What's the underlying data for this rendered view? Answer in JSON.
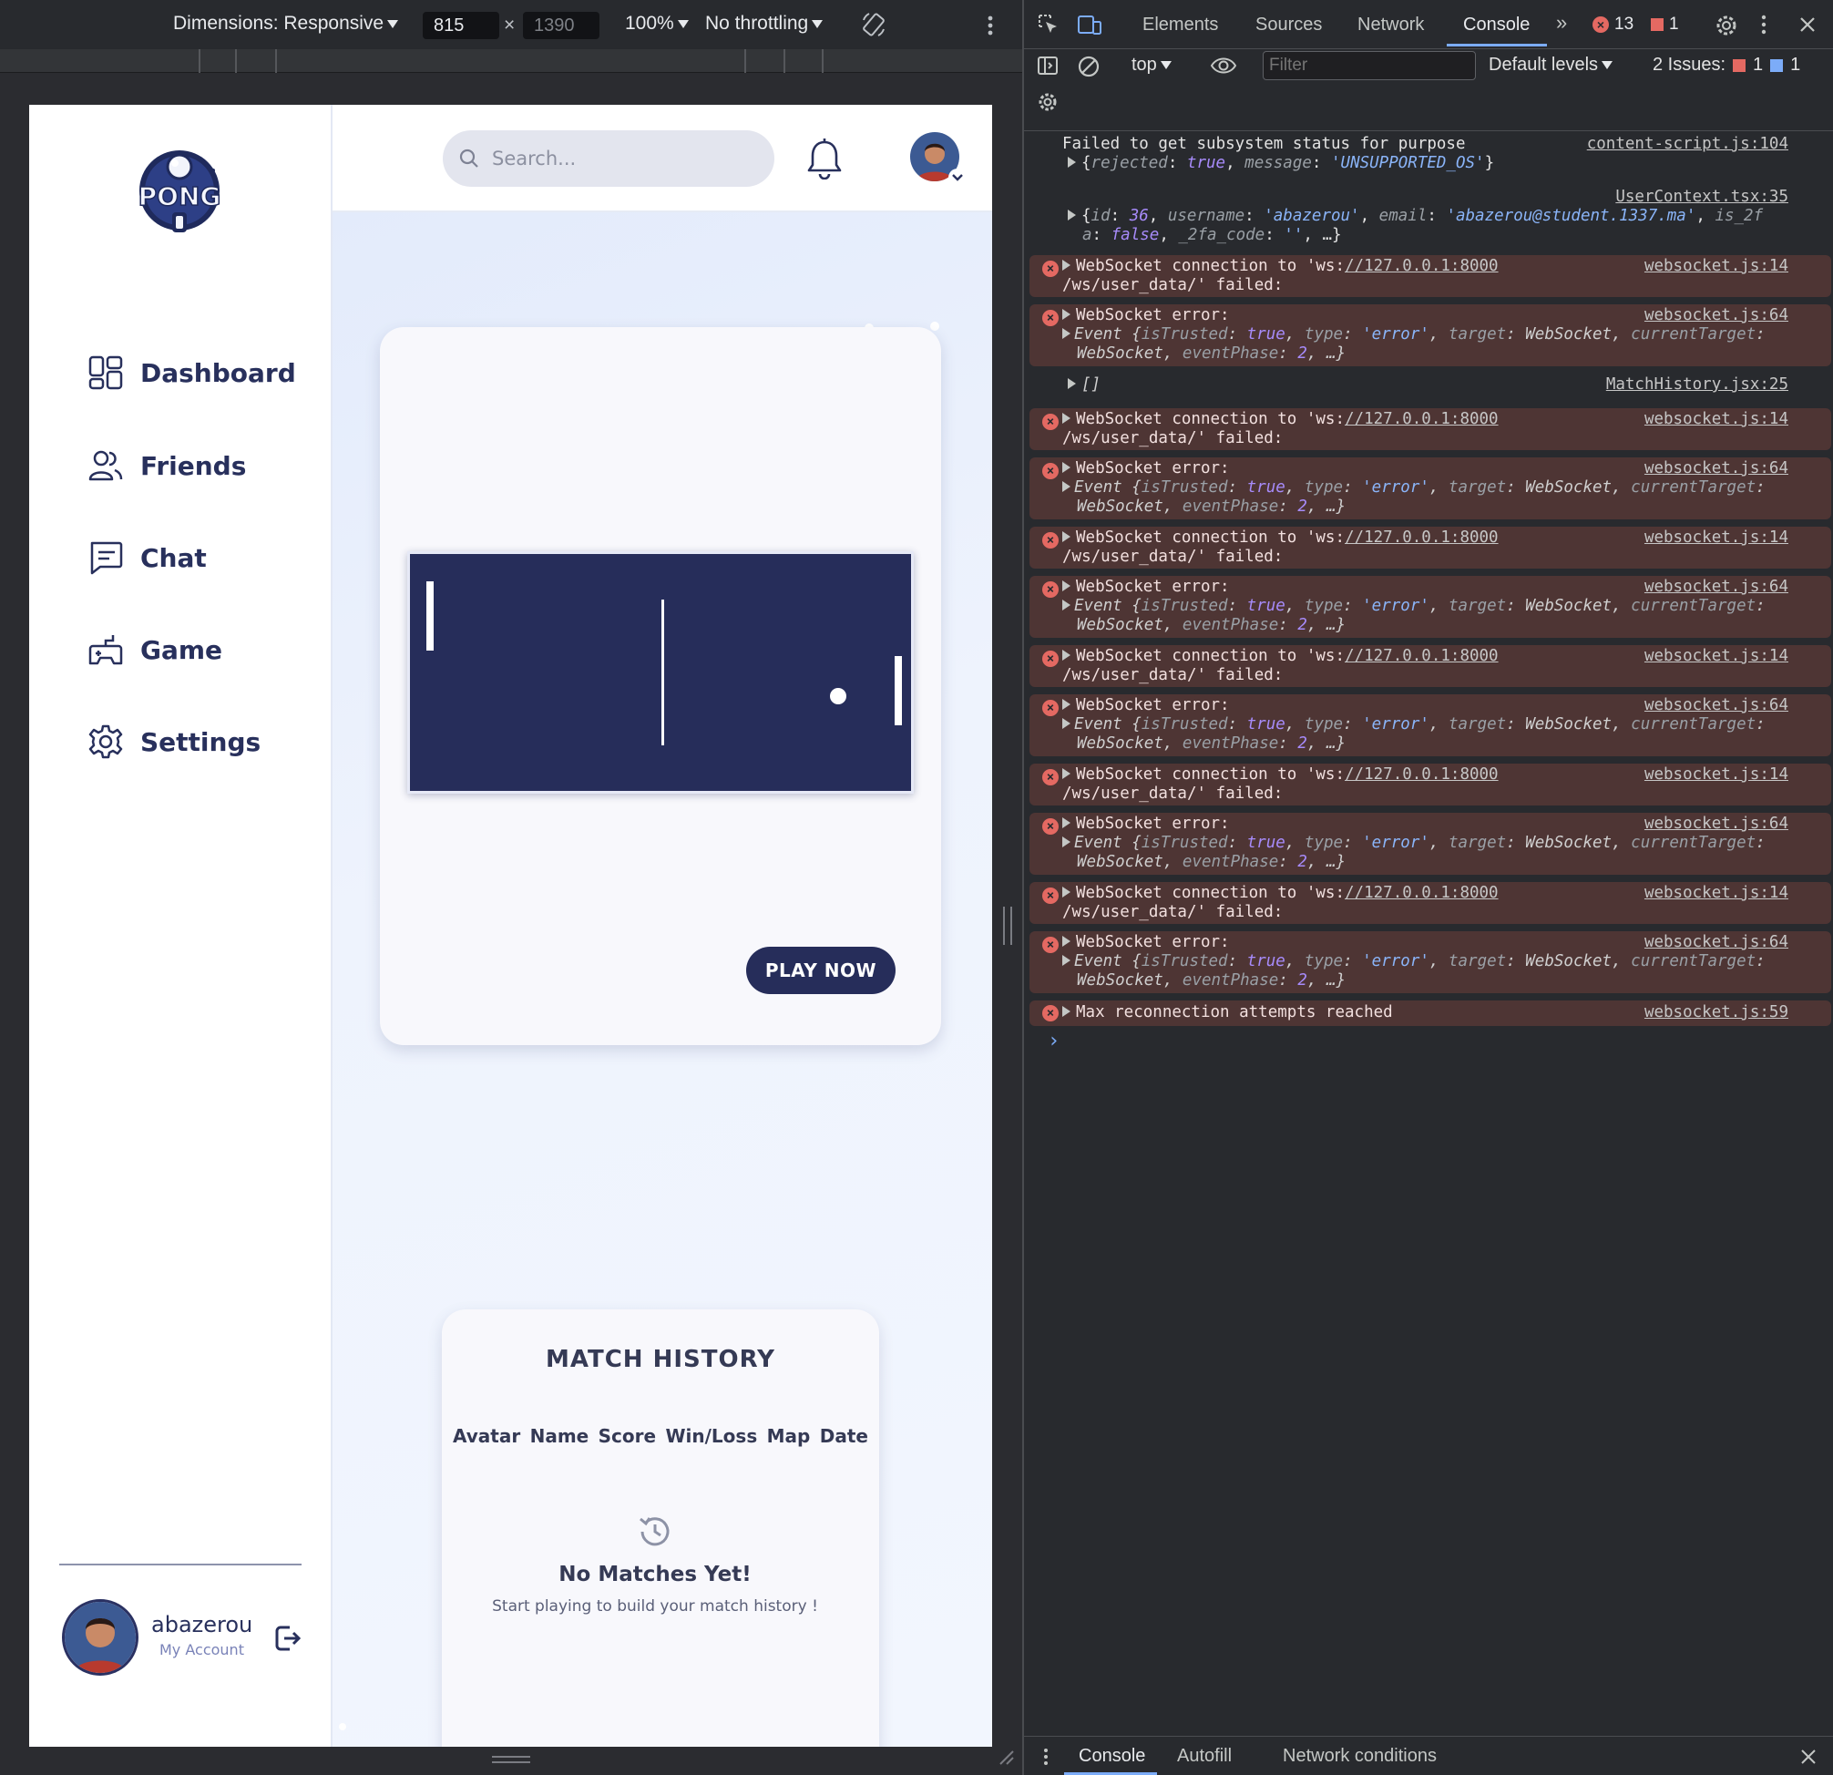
{
  "device_toolbar": {
    "dimensions_label": "Dimensions: Responsive",
    "width": "815",
    "height": "1390",
    "zoom": "100%",
    "throttling": "No throttling",
    "times": "×"
  },
  "app": {
    "sidebar": {
      "logo_text": "PONG",
      "items": [
        {
          "label": "Dashboard",
          "icon": "dashboard-icon"
        },
        {
          "label": "Friends",
          "icon": "friends-icon"
        },
        {
          "label": "Chat",
          "icon": "chat-icon"
        },
        {
          "label": "Game",
          "icon": "gamepad-icon"
        },
        {
          "label": "Settings",
          "icon": "gear-icon"
        }
      ],
      "account": {
        "name": "abazerou",
        "subtitle": "My Account"
      }
    },
    "topbar": {
      "search_placeholder": "Search..."
    },
    "game_card": {
      "play_label": "PLAY NOW"
    },
    "match_history": {
      "title": "MATCH HISTORY",
      "columns": [
        "Avatar",
        "Name",
        "Score",
        "Win/Loss",
        "Map",
        "Date"
      ],
      "empty_title": "No Matches Yet!",
      "empty_subtitle": "Start playing to build your match history !"
    }
  },
  "devtools": {
    "tabs": [
      "Elements",
      "Sources",
      "Network",
      "Console"
    ],
    "active_tab": "Console",
    "error_count": "13",
    "issue_count": "1",
    "context": "top",
    "filter_placeholder": "Filter",
    "levels": "Default levels",
    "issues_label": "2 Issues:",
    "issues_red": "1",
    "issues_blue": "1",
    "drawer_tabs": [
      "Console",
      "Autofill",
      "Network conditions"
    ],
    "colors": {
      "error_bg": "#4e3534",
      "accent": "#7cacf8",
      "error_red": "#e46962"
    },
    "logs": {
      "l1_text": "Failed to get subsystem status for purpose",
      "l1_src": "content-script.js:104",
      "l1_obj_rejected": "true",
      "l1_obj_message": "'UNSUPPORTED_OS'",
      "l2_src": "UserContext.tsx:35",
      "l2_id": "36",
      "l2_username": "'abazerou'",
      "l2_email": "'abazerou@student.1337.ma'",
      "ws_conn_prefix": "WebSocket connection to 'ws:",
      "ws_url": "//127.0.0.1:8000",
      "ws_path": "/ws/user_data/' failed:",
      "ws_conn_src": "websocket.js:14",
      "ws_err_title": "WebSocket error:",
      "ws_err_src": "websocket.js:64",
      "empty_array": "[]",
      "match_src": "MatchHistory.jsx:25",
      "max_text": "Max reconnection attempts reached",
      "max_src": "websocket.js:59"
    }
  }
}
